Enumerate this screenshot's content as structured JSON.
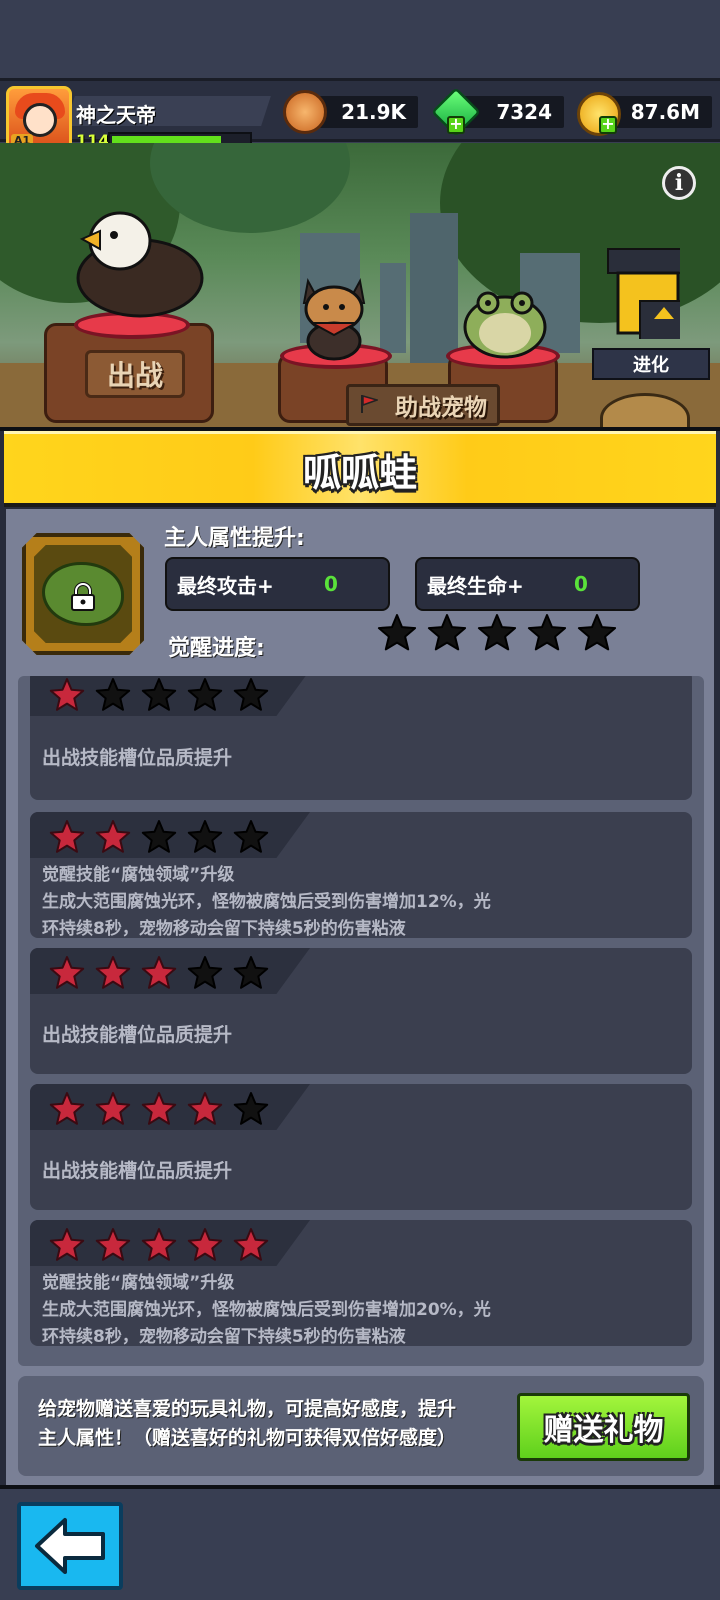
{
  "player": {
    "name": "神之天帝",
    "level": "114",
    "avatar_badge": "A1",
    "xp_fraction": 0.8
  },
  "resources": [
    {
      "icon": "coin-face-icon",
      "value": "21.9K"
    },
    {
      "icon": "green-gem-icon",
      "value": "7324"
    },
    {
      "icon": "gold-coin-icon",
      "value": "87.6M"
    }
  ],
  "scene": {
    "battle_label": "出战",
    "assist_label": "助战宠物",
    "evolve_label": "进化"
  },
  "pet": {
    "name": "呱呱蛙",
    "attr_title": "主人属性提升:",
    "stats": [
      {
        "label": "最终攻击+",
        "value": "0"
      },
      {
        "label": "最终生命+",
        "value": "0"
      }
    ],
    "awaken_label": "觉醒进度:",
    "awaken_stars": 0,
    "awaken_max": 5
  },
  "tiers": [
    {
      "stars": 1,
      "lines": [
        "出战技能槽位品质提升"
      ]
    },
    {
      "stars": 2,
      "lines": [
        "觉醒技能“腐蚀领域”升级",
        "生成大范围腐蚀光环，怪物被腐蚀后受到伤害增加12%，光",
        "环持续8秒，宠物移动会留下持续5秒的伤害粘液"
      ]
    },
    {
      "stars": 3,
      "lines": [
        "出战技能槽位品质提升"
      ]
    },
    {
      "stars": 4,
      "lines": [
        "出战技能槽位品质提升"
      ]
    },
    {
      "stars": 5,
      "lines": [
        "觉醒技能“腐蚀领域”升级",
        "生成大范围腐蚀光环，怪物被腐蚀后受到伤害增加20%，光",
        "环持续8秒，宠物移动会留下持续5秒的伤害粘液"
      ]
    }
  ],
  "gift": {
    "text_line1": "给宠物赠送喜爱的玩具礼物，可提高好感度，提升",
    "text_line2": "主人属性！（赠送喜好的礼物可获得双倍好感度）",
    "button_label": "赠送礼物"
  },
  "colors": {
    "banner": "#ffd51c",
    "star_filled": "#c8283c",
    "star_empty": "#111111",
    "stat_value": "#5ae23a",
    "gift_button": "#7ee22a",
    "back_button": "#19b8f0"
  }
}
